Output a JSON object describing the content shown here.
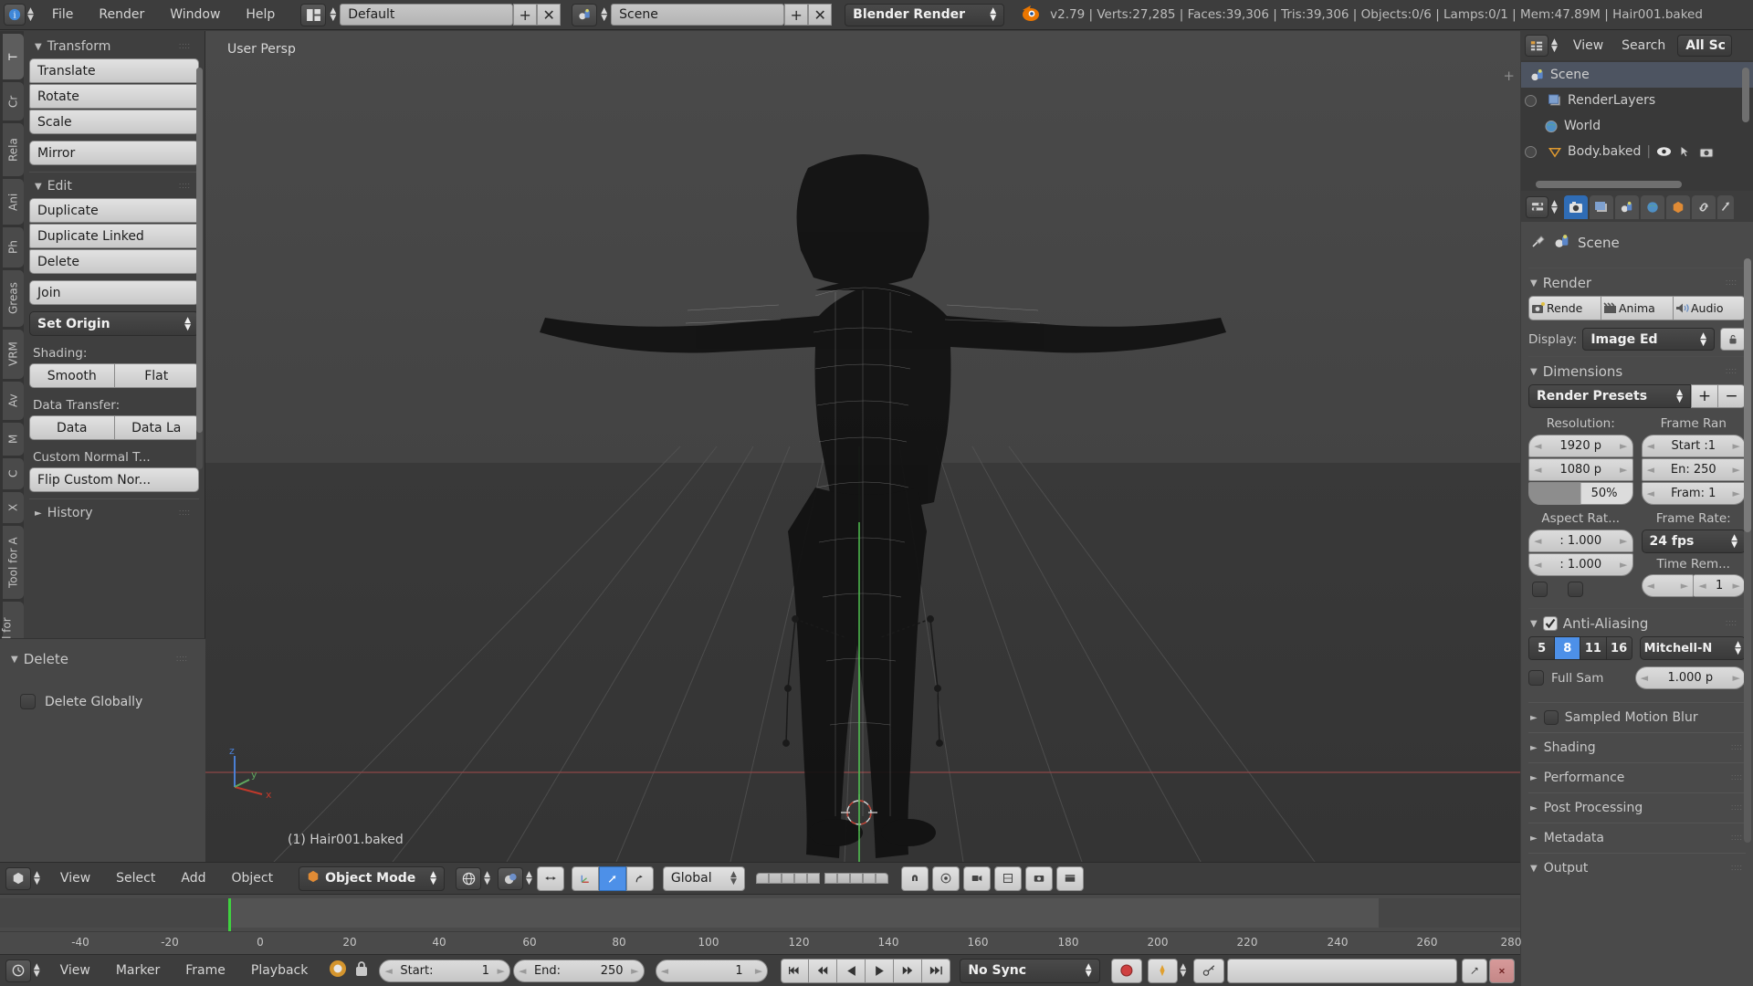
{
  "topbar": {
    "logo_icon": "blender-info-icon",
    "menus": [
      "File",
      "Render",
      "Window",
      "Help"
    ],
    "screen_icon": "screen-layout-icon",
    "screen_value": "Default",
    "add_label": "+",
    "remove_label": "✕",
    "scene_icon": "scene-icon",
    "scene_value": "Scene",
    "engine_label": "Blender Render",
    "blender_icon": "blender-logo-icon",
    "stats": "v2.79 | Verts:27,285 | Faces:39,306 | Tris:39,306 | Objects:0/6 | Lamps:0/1 | Mem:47.89M | Hair001.baked"
  },
  "toolshelf": {
    "tabs": [
      "T",
      "Cr",
      "Rela",
      "Ani",
      "Ph",
      "Greas",
      "VRM",
      "Av",
      "M",
      "C",
      "X",
      "Tool for A",
      "Easy Tool for A"
    ],
    "transform": {
      "title": "Transform",
      "buttons": [
        "Translate",
        "Rotate",
        "Scale"
      ],
      "mirror": "Mirror"
    },
    "edit": {
      "title": "Edit",
      "buttons": [
        "Duplicate",
        "Duplicate Linked",
        "Delete"
      ],
      "join": "Join",
      "set_origin": "Set Origin",
      "shading_label": "Shading:",
      "shading": [
        "Smooth",
        "Flat"
      ],
      "data_transfer_label": "Data Transfer:",
      "data_transfer": [
        "Data",
        "Data La"
      ],
      "custom_normal": "Custom Normal T...",
      "flip_custom_normal": "Flip Custom Nor..."
    },
    "history": {
      "title": "History"
    },
    "delete_panel": {
      "title": "Delete",
      "checkbox_label": "Delete Globally"
    }
  },
  "viewport": {
    "persp_label": "User Persp",
    "object_label": "(1) Hair001.baked",
    "axis_x": "x",
    "axis_y": "y",
    "axis_z": "z"
  },
  "v3d_header": {
    "editor_icon": "editor-type-3dview-icon",
    "menus": [
      "View",
      "Select",
      "Add",
      "Object"
    ],
    "mode_icon": "object-mode-icon",
    "mode_value": "Object Mode",
    "pivot_icon": "pivot-median-icon",
    "shading_icon": "viewport-shading-solid-icon",
    "manipulator_icon": "manipulator-toggle-icon",
    "translate_icon": "translate-manipulator-icon",
    "rotate_icon": "rotate-manipulator-icon",
    "scale_icon": "scale-manipulator-icon",
    "orientation_value": "Global",
    "snap_icon": "snap-magnet-icon",
    "proportional_icon": "proportional-edit-icon",
    "render_icon": "render-preview-icon",
    "camera_icon": "camera-render-icon"
  },
  "timeline": {
    "ticks": [
      "-40",
      "-20",
      "0",
      "20",
      "40",
      "60",
      "80",
      "100",
      "120",
      "140",
      "160",
      "180",
      "200",
      "220",
      "240",
      "260",
      "280"
    ],
    "header": {
      "editor_icon": "editor-type-timeline-icon",
      "menus": [
        "View",
        "Marker",
        "Frame",
        "Playback"
      ],
      "keyingset_icon": "keying-set-icon",
      "lock_icon": "lock-icon",
      "start_label": "Start:",
      "start_value": "1",
      "end_label": "End:",
      "end_value": "250",
      "current_frame": "1",
      "transport": [
        "jump-start-icon",
        "prev-keyframe-icon",
        "play-reverse-icon",
        "play-icon",
        "next-keyframe-icon",
        "jump-end-icon"
      ],
      "sync_value": "No Sync",
      "record_icon": "record-icon",
      "autokey_icon": "auto-keying-icon",
      "keyingset_value_icon": "keyingset-dropdown-icon",
      "field_placeholder": ""
    }
  },
  "outliner": {
    "editor_icon": "editor-type-outliner-icon",
    "menus": [
      "View",
      "Search"
    ],
    "display_mode": "All Sc",
    "rows": [
      {
        "label": "Scene",
        "icon": "scene-icon",
        "indent": 0,
        "selected": true,
        "expandable": false
      },
      {
        "label": "RenderLayers",
        "icon": "renderlayers-icon",
        "indent": 1,
        "selected": false,
        "expandable": true
      },
      {
        "label": "World",
        "icon": "world-icon",
        "indent": 1,
        "selected": false,
        "expandable": false
      },
      {
        "label": "Body.baked",
        "icon": "mesh-triangle-icon",
        "indent": 1,
        "selected": false,
        "expandable": true
      }
    ],
    "row_icons": [
      "eye-icon",
      "cursor-select-icon",
      "camera-restrict-icon"
    ]
  },
  "properties": {
    "tabs": [
      "properties-editor-icon",
      "render-tab-icon",
      "renderlayers-tab-icon",
      "scene-tab-icon",
      "world-tab-icon",
      "object-tab-icon",
      "constraints-tab-icon",
      "modifiers-tab-icon"
    ],
    "breadcrumb": {
      "pin_icon": "pin-icon",
      "scene_icon": "scene-icon",
      "label": "Scene"
    },
    "render": {
      "title": "Render",
      "buttons": [
        {
          "label": "Rende",
          "icon": "render-image-icon"
        },
        {
          "label": "Anima",
          "icon": "render-animation-icon"
        },
        {
          "label": "Audio",
          "icon": "render-audio-icon"
        }
      ],
      "display_label": "Display:",
      "display_value": "Image Ed",
      "lock_icon": "unlock-interface-icon"
    },
    "dimensions": {
      "title": "Dimensions",
      "preset_label": "Render Presets",
      "add_label": "+",
      "remove_label": "−",
      "resolution_label": "Resolution:",
      "resolution_x": "1920 p",
      "resolution_y": "1080 p",
      "resolution_pct": "50%",
      "frame_range_label": "Frame Ran",
      "frame_start": "Start :1",
      "frame_end": "En: 250",
      "frame_step": "Fram: 1",
      "aspect_label": "Aspect Rat...",
      "aspect_x": ": 1.000",
      "aspect_y": ": 1.000",
      "frame_rate_label": "Frame Rate:",
      "frame_rate_value": "24 fps",
      "time_remap_label": "Time Rem...",
      "time_remap_old": "",
      "time_remap_new": "1"
    },
    "antialiasing": {
      "title": "Anti-Aliasing",
      "enabled": true,
      "samples": [
        "5",
        "8",
        "11",
        "16"
      ],
      "selected_sample": "8",
      "filter_value": "Mitchell-N",
      "full_sample_label": "Full Sam",
      "filter_size": "1.000 p"
    },
    "collapsed_panels": [
      {
        "label": "Sampled Motion Blur",
        "has_checkbox": true
      },
      {
        "label": "Shading",
        "has_checkbox": false
      },
      {
        "label": "Performance",
        "has_checkbox": false
      },
      {
        "label": "Post Processing",
        "has_checkbox": false
      },
      {
        "label": "Metadata",
        "has_checkbox": false
      }
    ],
    "output_panel": {
      "label": "Output",
      "open": true
    }
  },
  "colors": {
    "accent_blue": "#4d90e8",
    "tab_active_blue": "#2f6cb5",
    "panel_bg": "#4a4a4a",
    "header_bg": "#3d3d3d",
    "viewport_bg": "#3b3b3b",
    "playhead_green": "#3fd13f",
    "record_red": "#cf4040"
  }
}
